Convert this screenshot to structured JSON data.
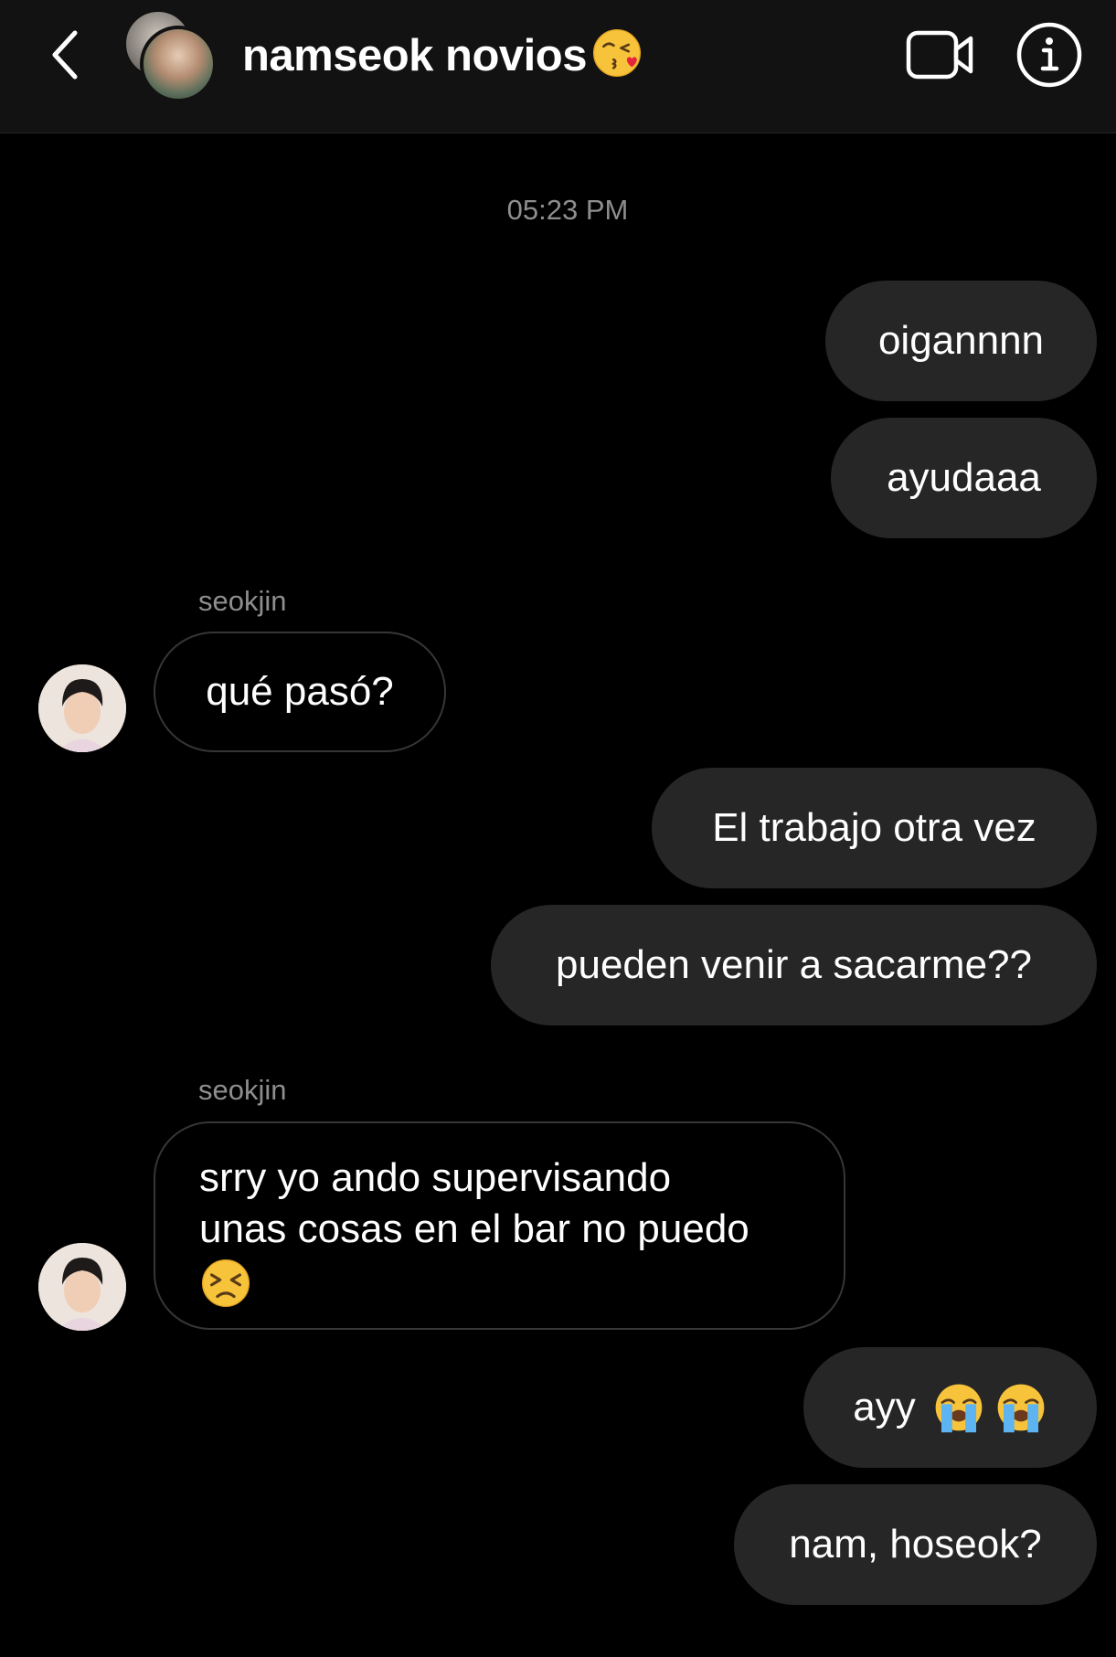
{
  "header": {
    "title": "namseok novios",
    "title_emoji": "face-blowing-kiss-emoji",
    "back_icon": "chevron-left-icon",
    "video_icon": "video-camera-icon",
    "info_icon": "info-icon"
  },
  "conversation": {
    "timestamp": "05:23 PM",
    "messages": [
      {
        "type": "sent",
        "text": "oigannnn"
      },
      {
        "type": "sent",
        "text": "ayudaaa"
      },
      {
        "type": "received",
        "sender": "seokjin",
        "text": "qué pasó?"
      },
      {
        "type": "sent",
        "text": "El trabajo otra vez"
      },
      {
        "type": "sent",
        "text": "pueden venir a sacarme??"
      },
      {
        "type": "received",
        "sender": "seokjin",
        "line1": "srry yo ando supervisando",
        "line2": "unas cosas en el bar no puedo",
        "emoji": "persevering-face-emoji"
      },
      {
        "type": "sent",
        "text": "ayy",
        "emoji": "loudly-crying-face-emoji",
        "emoji_count": 2
      },
      {
        "type": "sent",
        "text": "nam, hoseok?"
      }
    ]
  },
  "colors": {
    "background": "#000000",
    "header_background": "#121212",
    "sent_bubble": "#262626",
    "received_border": "#363636",
    "muted_text": "#8e8e8e"
  }
}
